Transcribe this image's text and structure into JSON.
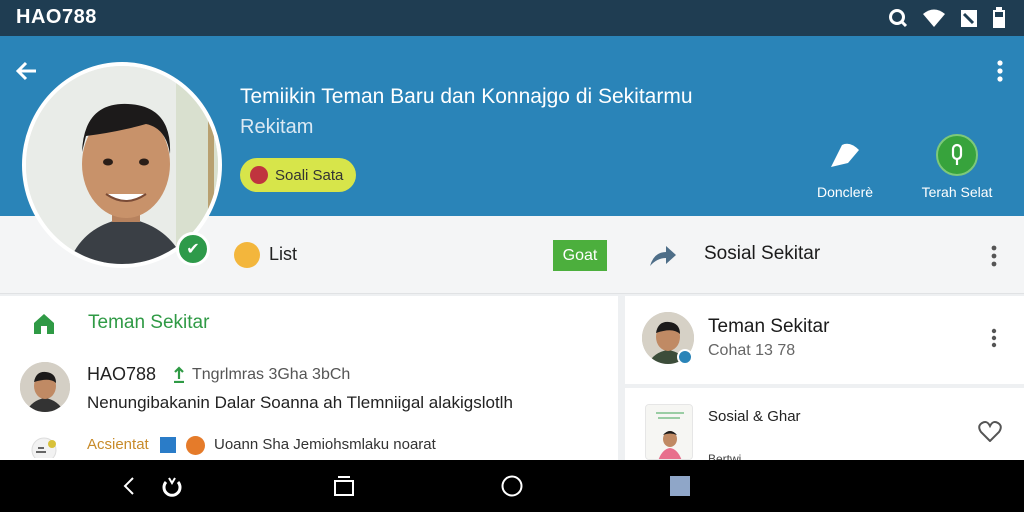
{
  "status_bar": {
    "app_name": "HAO788",
    "icons": [
      "search-icon",
      "wifi-icon",
      "signal-icon",
      "battery-icon"
    ]
  },
  "header": {
    "title": "Temiikin Teman Baru dan Konnajgo di Sekitarmu",
    "subtitle": "Rekitam",
    "pill_label": "Soali Sata",
    "actions": [
      {
        "label": "Donclerè",
        "icon": "bookmark-icon"
      },
      {
        "label": "Terah Selat",
        "icon": "microphone-icon"
      }
    ],
    "colors": {
      "primary": "#2a84b8",
      "accent": "#d7e54a",
      "success": "#37a33c"
    }
  },
  "sub_toolbar": {
    "list_label": "List",
    "go_label": "Goat",
    "title": "Sosial Sekitar"
  },
  "left_card": {
    "title": "Teman Sekitar",
    "post": {
      "name": "HAO788",
      "meta": "Tngrlmras 3Gha 3bCh",
      "text": "Nenungibakanin Dalar Soanna ah Tlemniigal alakigslotlh"
    },
    "footer": {
      "label": "Acsientat",
      "text": "Uoann Sha Jemiohsmlaku noarat"
    }
  },
  "right_cards": [
    {
      "title": "Teman Sekitar",
      "subtitle": "Cohat 13 78"
    },
    {
      "title": "Sosial & Ghar",
      "subtitle": "Bertwi..."
    }
  ],
  "nav_bar": {
    "items": [
      "back-icon",
      "gesture-icon",
      "recents-icon",
      "home-icon",
      "square-icon"
    ]
  }
}
